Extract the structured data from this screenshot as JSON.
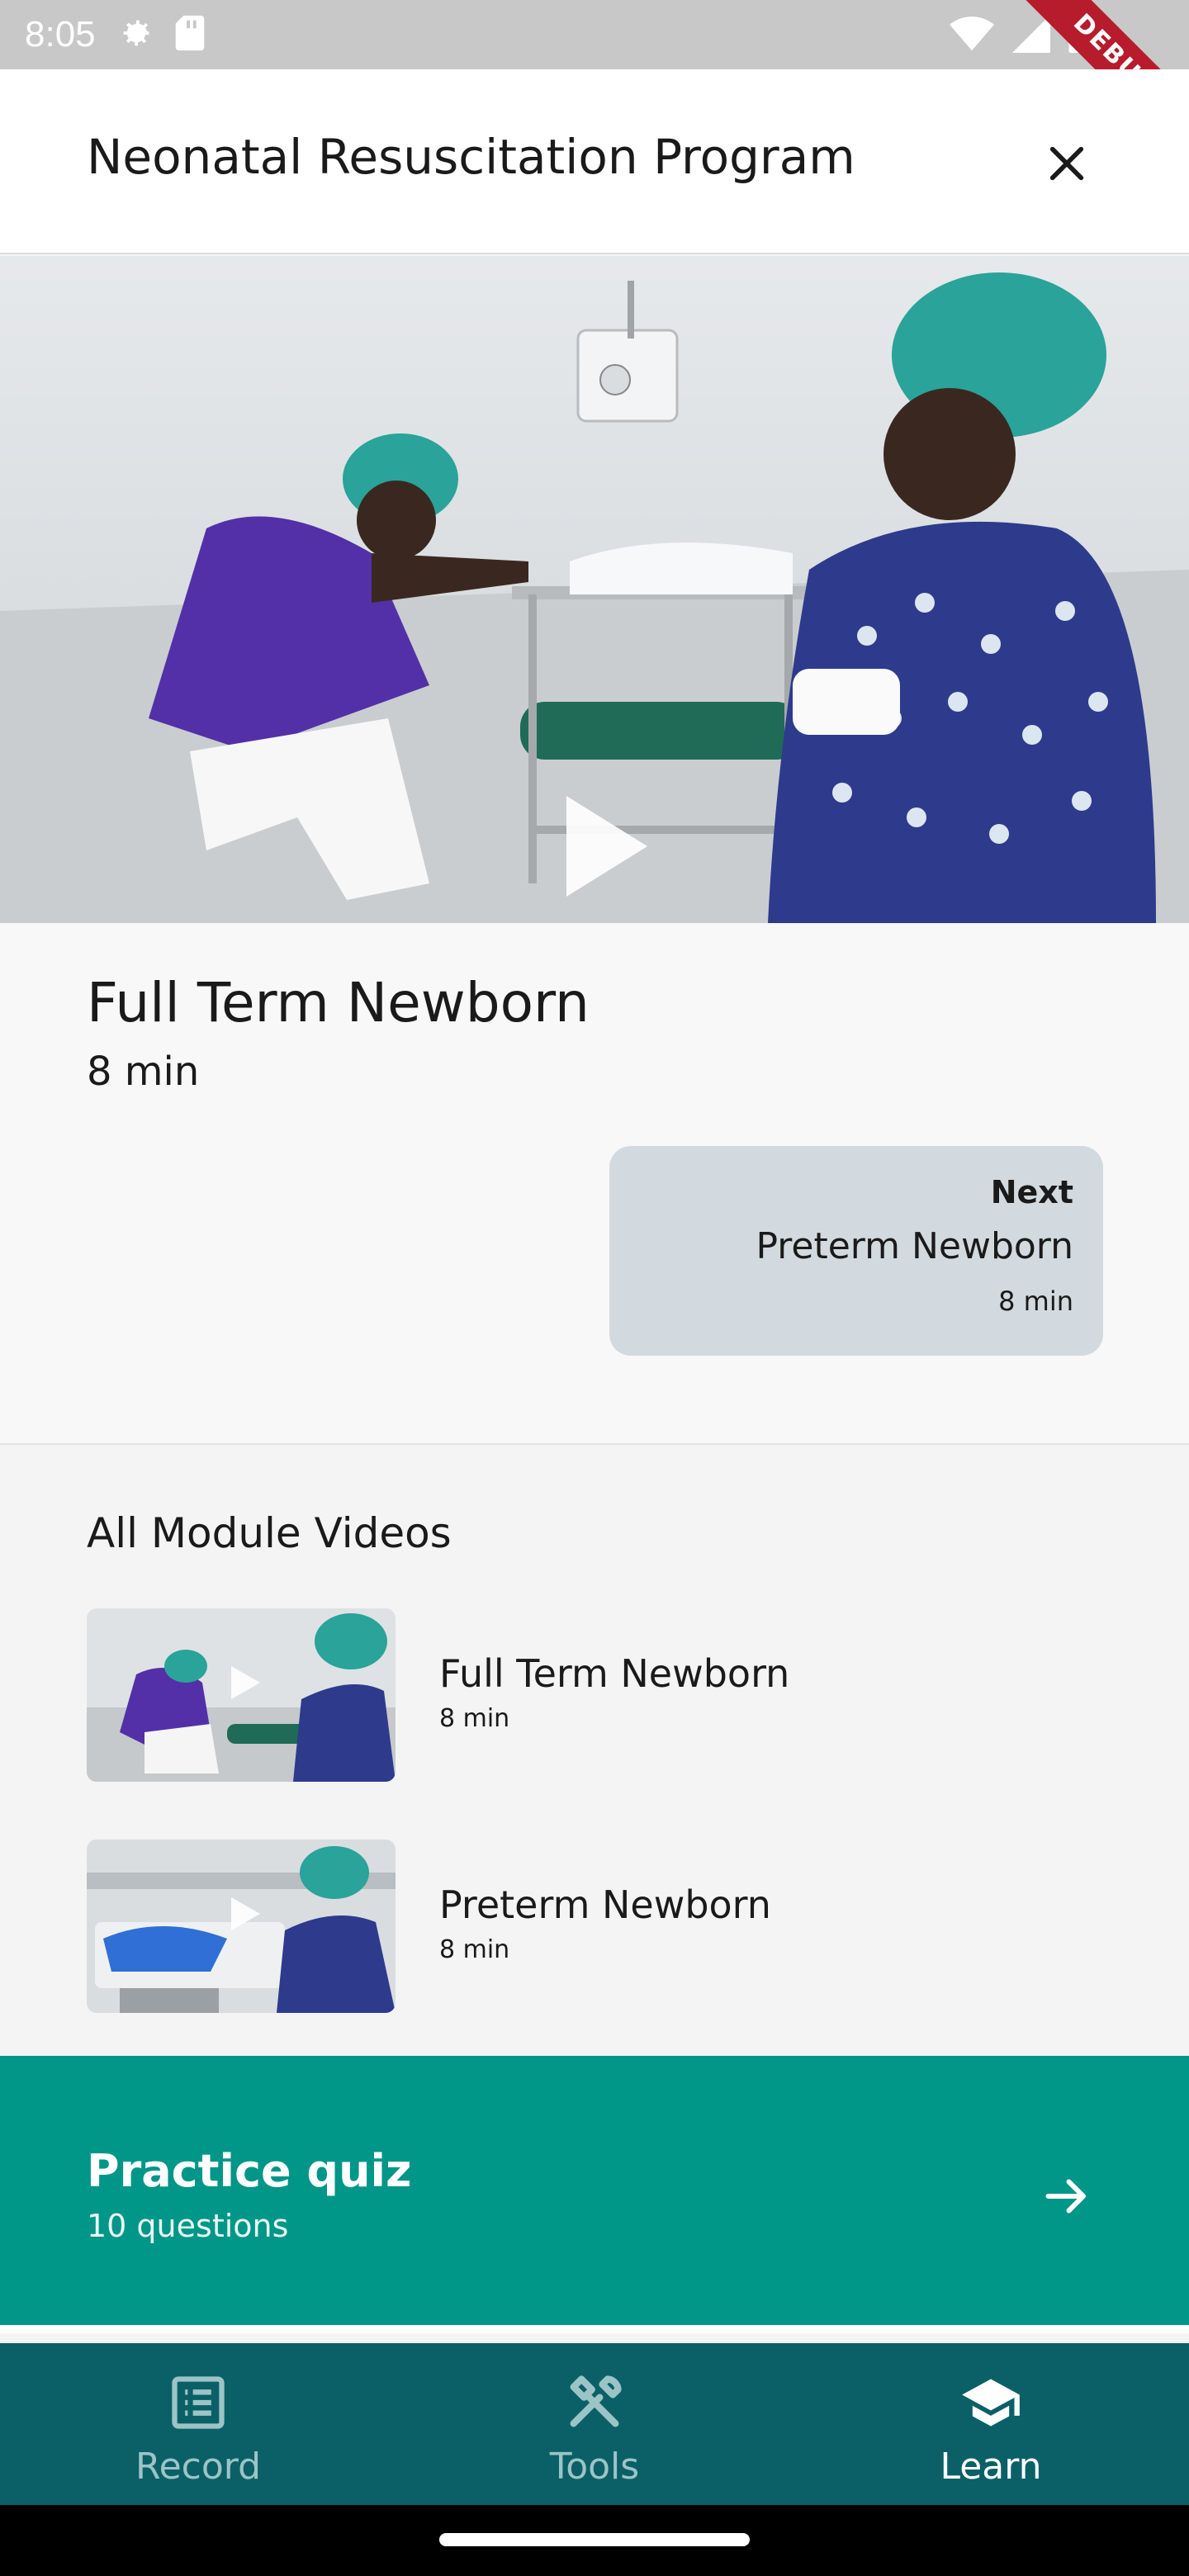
{
  "status_bar": {
    "time": "8:05",
    "debug_label": "DEBUG"
  },
  "app_bar": {
    "title": "Neonatal Resuscitation Program",
    "close_icon": "close-icon"
  },
  "current_video": {
    "title": "Full Term Newborn",
    "duration": "8 min"
  },
  "next_card": {
    "label": "Next",
    "title": "Preterm Newborn",
    "duration": "8 min"
  },
  "module": {
    "heading": "All Module Videos",
    "items": [
      {
        "title": "Full Term Newborn",
        "duration": "8 min"
      },
      {
        "title": "Preterm Newborn",
        "duration": "8 min"
      }
    ]
  },
  "quiz": {
    "title": "Practice quiz",
    "subtitle": "10 questions",
    "icon": "arrow-right-icon"
  },
  "bottom_nav": {
    "items": [
      {
        "label": "Record",
        "icon": "list-icon",
        "active": false
      },
      {
        "label": "Tools",
        "icon": "tools-icon",
        "active": false
      },
      {
        "label": "Learn",
        "icon": "graduation-cap-icon",
        "active": true
      }
    ]
  },
  "colors": {
    "accent": "#009688",
    "nav_bg": "#0b6067",
    "next_card_bg": "#d3dadf"
  }
}
